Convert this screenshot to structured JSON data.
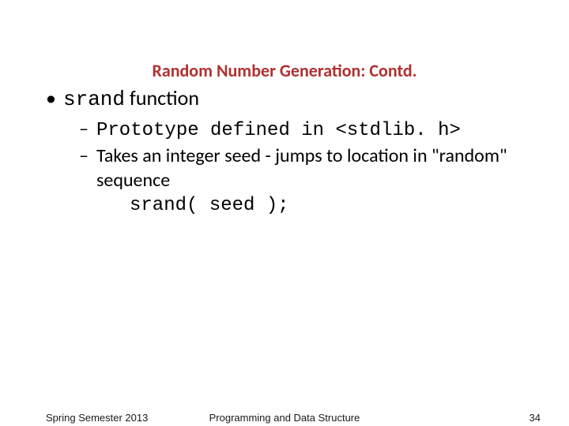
{
  "title": "Random Number Generation: Contd.",
  "bullet": {
    "code": "srand",
    "text_after": " function"
  },
  "sub1": {
    "prefix": "Prototype defined in ",
    "code": "<stdlib. h>"
  },
  "sub2": "Takes an integer seed - jumps to location in \"random\" sequence",
  "codeLine": "srand( seed );",
  "footer": {
    "left": "Spring Semester 2013",
    "mid": "Programming and Data Structure",
    "right": "34"
  }
}
